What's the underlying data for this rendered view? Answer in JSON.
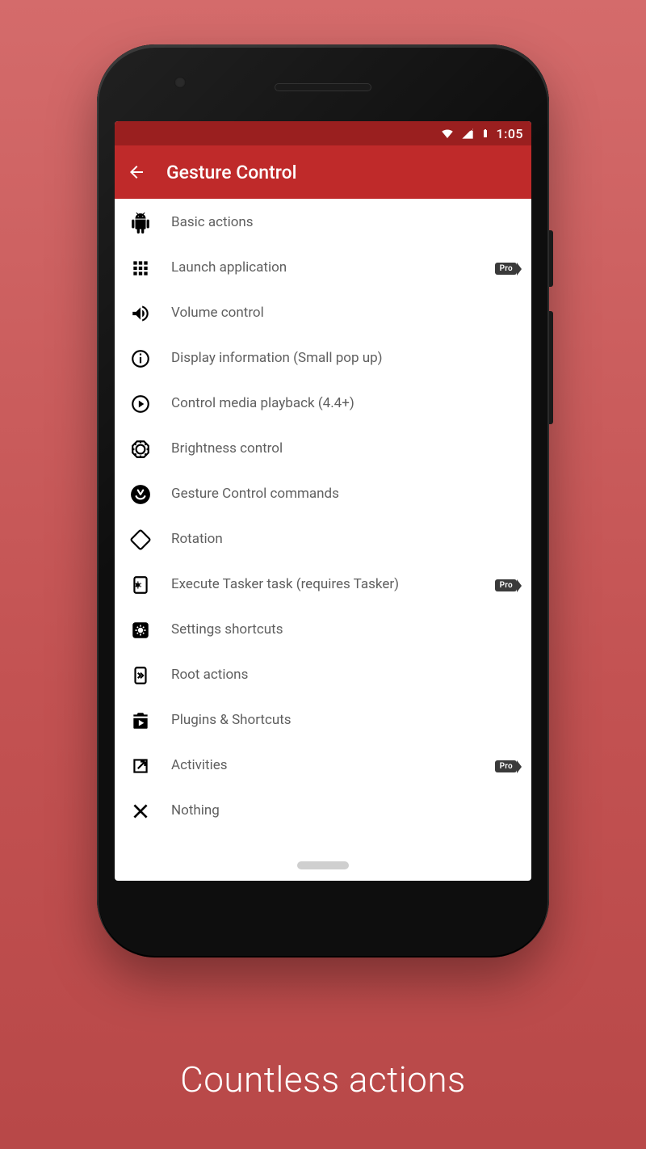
{
  "caption": "Countless actions",
  "statusbar": {
    "time": "1:05"
  },
  "appbar": {
    "title": "Gesture Control"
  },
  "badge": {
    "pro": "Pro"
  },
  "list": {
    "items": [
      {
        "icon": "android-icon",
        "label": "Basic actions",
        "pro": false
      },
      {
        "icon": "apps-grid-icon",
        "label": "Launch application",
        "pro": true
      },
      {
        "icon": "volume-icon",
        "label": "Volume control",
        "pro": false
      },
      {
        "icon": "info-icon",
        "label": "Display information (Small pop up)",
        "pro": false
      },
      {
        "icon": "play-circle-icon",
        "label": "Control media playback (4.4+)",
        "pro": false
      },
      {
        "icon": "brightness-icon",
        "label": "Brightness control",
        "pro": false
      },
      {
        "icon": "gesture-icon",
        "label": "Gesture Control commands",
        "pro": false
      },
      {
        "icon": "rotation-icon",
        "label": "Rotation",
        "pro": false
      },
      {
        "icon": "tasker-icon",
        "label": "Execute Tasker task (requires Tasker)",
        "pro": true
      },
      {
        "icon": "settings-app-icon",
        "label": "Settings shortcuts",
        "pro": false
      },
      {
        "icon": "root-icon",
        "label": "Root actions",
        "pro": false
      },
      {
        "icon": "shop-play-icon",
        "label": "Plugins & Shortcuts",
        "pro": false
      },
      {
        "icon": "open-in-new-icon",
        "label": "Activities",
        "pro": true
      },
      {
        "icon": "close-icon",
        "label": "Nothing",
        "pro": false
      }
    ]
  }
}
